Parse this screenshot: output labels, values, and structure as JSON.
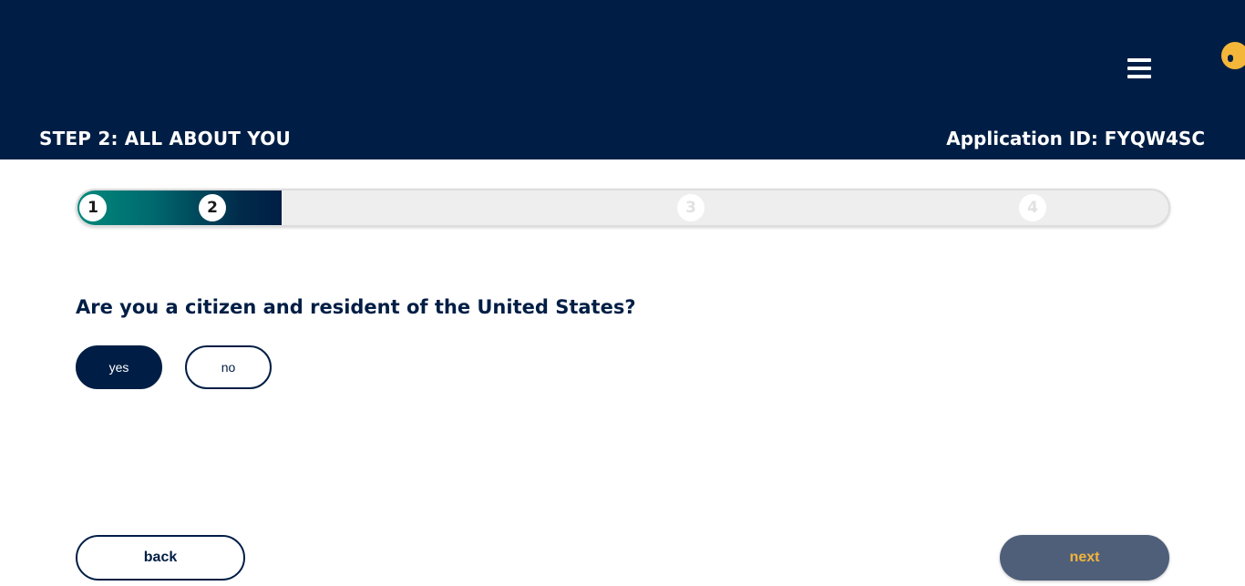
{
  "header": {
    "step_title": "STEP 2: ALL ABOUT YOU",
    "application_id": "Application ID: FYQW4SC",
    "menu_icon": "hamburger-menu-icon",
    "help_icon": "help-icon",
    "colors": {
      "background": "#001e45",
      "text": "#ffffff",
      "accent": "#f4b73a"
    }
  },
  "progress": {
    "current_step": 2,
    "total_steps": 4,
    "steps": [
      {
        "label": "1",
        "state": "complete"
      },
      {
        "label": "2",
        "state": "current"
      },
      {
        "label": "3",
        "state": "upcoming"
      },
      {
        "label": "4",
        "state": "upcoming"
      }
    ],
    "colors": {
      "fill_start": "#00897b",
      "fill_end": "#001e45",
      "track": "#eeeeee"
    }
  },
  "question": {
    "text": "Are you a citizen and resident of the United States?",
    "options": [
      {
        "label": "yes",
        "selected": true
      },
      {
        "label": "no",
        "selected": false
      }
    ]
  },
  "navigation": {
    "back_label": "back",
    "next_label": "next",
    "colors": {
      "next_background": "#4f5f79",
      "next_text": "#f2b43a"
    }
  }
}
